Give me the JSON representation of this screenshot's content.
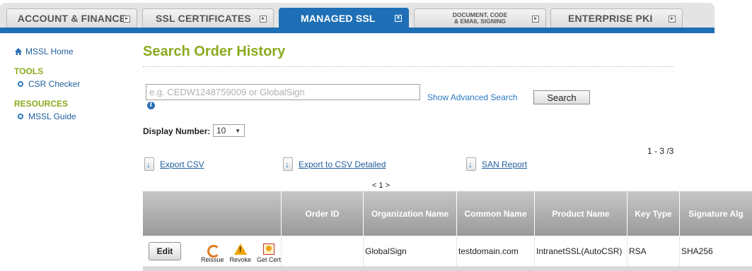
{
  "tabs": [
    {
      "label": "ACCOUNT & FINANCE",
      "active": false
    },
    {
      "label": "SSL CERTIFICATES",
      "active": false
    },
    {
      "label": "MANAGED SSL",
      "active": true
    },
    {
      "label": "DOCUMENT, CODE & EMAIL SIGNING",
      "line1": "DOCUMENT, CODE",
      "line2": "& EMAIL SIGNING",
      "active": false
    },
    {
      "label": "ENTERPRISE PKI",
      "active": false
    }
  ],
  "sidebar": {
    "home": "MSSL Home",
    "sections": [
      {
        "heading": "TOOLS",
        "items": [
          "CSR Checker"
        ]
      },
      {
        "heading": "RESOURCES",
        "items": [
          "MSSL Guide"
        ]
      }
    ]
  },
  "main": {
    "title": "Search Order History",
    "search": {
      "placeholder": "e.g. CEDW1248759009 or GlobalSign",
      "value": "",
      "advanced_link": "Show Advanced Search",
      "button": "Search"
    },
    "display_number": {
      "label": "Display Number:",
      "value": "10"
    },
    "range": "1 - 3 /3",
    "exports": [
      "Export CSV",
      "Export to CSV Detailed",
      "SAN Report"
    ],
    "pager": "< 1 >"
  },
  "table": {
    "columns": [
      "",
      "Order ID",
      "Organization Name",
      "Common Name",
      "Product Name",
      "Key Type",
      "Signature Alg"
    ],
    "actions": {
      "edit": "Edit",
      "reissue": "Reissue",
      "revoke": "Revoke",
      "get_cert": "Get Cert"
    },
    "rows": [
      {
        "order_id": "",
        "organization": "GlobalSign",
        "common_name": "testdomain.com",
        "product": "IntranetSSL(AutoCSR)",
        "key_type": "RSA",
        "signature_alg": "SHA256"
      }
    ]
  },
  "colors": {
    "brand_blue": "#1e6fb5",
    "title_green": "#8aab1e",
    "link_blue": "#1f5f9c"
  },
  "icons": [
    "home-icon",
    "bullet-icon",
    "info-icon",
    "export-icon",
    "reissue-icon",
    "revoke-icon",
    "get-cert-icon",
    "tab-arrow-icon"
  ]
}
